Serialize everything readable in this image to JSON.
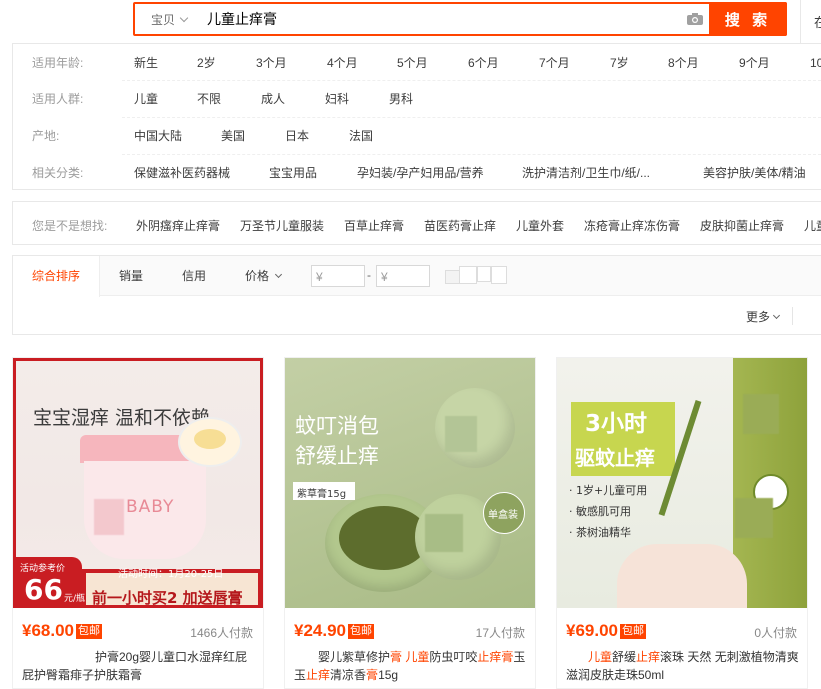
{
  "search": {
    "category": "宝贝",
    "query": "儿童止痒膏",
    "button_label": "搜 索",
    "right_edge_char": "在"
  },
  "filters": [
    {
      "label": "适用年龄:",
      "options": [
        "新生",
        "2岁",
        "3个月",
        "4个月",
        "5个月",
        "6个月",
        "7个月",
        "7岁",
        "8个月",
        "9个月",
        "10"
      ]
    },
    {
      "label": "适用人群:",
      "options": [
        "儿童",
        "不限",
        "成人",
        "妇科",
        "男科"
      ]
    },
    {
      "label": "产地:",
      "options": [
        "中国大陆",
        "美国",
        "日本",
        "法国"
      ]
    },
    {
      "label": "相关分类:",
      "options": [
        "保健滋补医药器械",
        "宝宝用品",
        "孕妇装/孕产妇用品/营养",
        "洗护清洁剂/卫生巾/纸/...",
        "美容护肤/美体/精油"
      ]
    }
  ],
  "guess": {
    "label": "您是不是想找:",
    "options": [
      "外阴瘙痒止痒膏",
      "万圣节儿童服装",
      "百草止痒膏",
      "苗医药膏止痒",
      "儿童外套",
      "冻疮膏止痒冻伤膏",
      "皮肤抑菌止痒膏",
      "儿童"
    ]
  },
  "sort": {
    "tabs": [
      "综合排序",
      "销量",
      "信用",
      "价格"
    ],
    "price_min_placeholder": "¥",
    "price_max_placeholder": "¥",
    "dash": "-",
    "more_label": "更多"
  },
  "products": [
    {
      "price": "¥68.00",
      "badge": "包邮",
      "sold": "1466人付款",
      "title_parts": [
        {
          "t": "护膏20g婴儿童口水湿痒红屁屁护臀霜痱子护肤霜膏",
          "hl": false
        }
      ],
      "pic": {
        "headline": "宝宝湿痒 温和不依赖",
        "jar_text": "BABY",
        "promo_ref": "活动参考价",
        "promo_price": "66",
        "promo_unit": "元/瓶",
        "event_time": "活动时间：1月20-25日",
        "promo_line": "前一小时买2 加送唇膏"
      }
    },
    {
      "price": "¥24.90",
      "badge": "包邮",
      "sold": "17人付款",
      "title_parts": [
        {
          "t": "婴儿紫草修护",
          "hl": false
        },
        {
          "t": "膏 儿童",
          "hl": true
        },
        {
          "t": "防虫叮咬",
          "hl": false
        },
        {
          "t": "止痒膏",
          "hl": true
        },
        {
          "t": "玉玉",
          "hl": false
        },
        {
          "t": "止痒",
          "hl": true
        },
        {
          "t": "清凉香",
          "hl": false
        },
        {
          "t": "膏",
          "hl": true
        },
        {
          "t": "15g",
          "hl": false
        }
      ],
      "pic": {
        "headline1": "蚊叮消包",
        "headline2": "舒缓止痒",
        "tag": "紫草膏15g",
        "box_tag": "单盒装"
      }
    },
    {
      "price": "¥69.00",
      "badge": "包邮",
      "sold": "0人付款",
      "title_parts": [
        {
          "t": "儿童",
          "hl": true
        },
        {
          "t": "舒缓",
          "hl": false
        },
        {
          "t": "止痒",
          "hl": true
        },
        {
          "t": "滚珠 天然 无刺激植物清爽滋润皮肤走珠50ml",
          "hl": false
        }
      ],
      "pic": {
        "headline1": "3小时",
        "headline2": "驱蚊止痒",
        "bullets": [
          "· 1岁+儿童可用",
          "· 敏感肌可用",
          "· 茶树油精华"
        ]
      }
    }
  ],
  "colors": {
    "accent": "#ff4400",
    "label_gray": "#9c9c9c",
    "border": "#e8e8e8"
  }
}
